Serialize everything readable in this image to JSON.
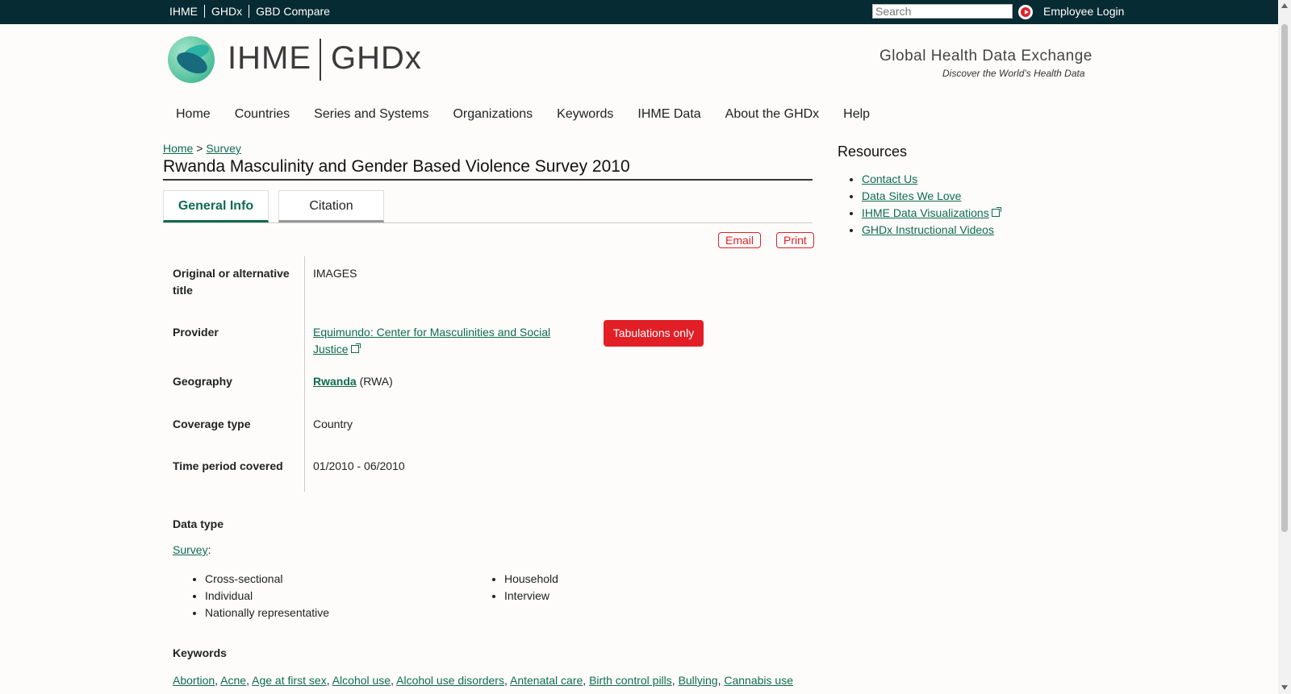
{
  "topbar": {
    "links": [
      "IHME",
      "GHDx",
      "GBD Compare"
    ],
    "search_placeholder": "Search",
    "login": "Employee Login"
  },
  "logo": {
    "left_text": "IHME",
    "right_text": "GHDx"
  },
  "tagline": {
    "main": "Global Health Data Exchange",
    "sub": "Discover the World’s Health Data"
  },
  "nav": [
    "Home",
    "Countries",
    "Series and Systems",
    "Organizations",
    "Keywords",
    "IHME Data",
    "About the GHDx",
    "Help"
  ],
  "breadcrumb": {
    "home": "Home",
    "sep": " > ",
    "current": "Survey"
  },
  "page_title": "Rwanda Masculinity and Gender Based Violence Survey 2010",
  "tabs": [
    "General Info",
    "Citation"
  ],
  "actions": {
    "email": "Email",
    "print": "Print"
  },
  "info": {
    "alt_title_label": "Original or alternative title",
    "alt_title_value": "IMAGES",
    "provider_label": "Provider",
    "provider_value": "Equimundo: Center for Masculinities and Social Justice",
    "tabulations": "Tabulations only",
    "geography_label": "Geography",
    "geography_value": "Rwanda",
    "geography_code": "(RWA)",
    "coverage_label": "Coverage type",
    "coverage_value": "Country",
    "time_label": "Time period covered",
    "time_value": "01/2010 - 06/2010"
  },
  "data_type": {
    "heading": "Data type",
    "link": "Survey",
    "col1": [
      "Cross-sectional",
      "Individual",
      "Nationally representative"
    ],
    "col2": [
      "Household",
      "Interview"
    ]
  },
  "keywords": {
    "heading": "Keywords",
    "items": [
      "Abortion",
      "Acne",
      "Age at first sex",
      "Alcohol use",
      "Alcohol use disorders",
      "Antenatal care",
      "Birth control pills",
      "Bullying",
      "Cannabis use"
    ]
  },
  "resources": {
    "heading": "Resources",
    "items": [
      "Contact Us",
      "Data Sites We Love",
      "IHME Data Visualizations",
      "GHDx Instructional Videos"
    ]
  }
}
